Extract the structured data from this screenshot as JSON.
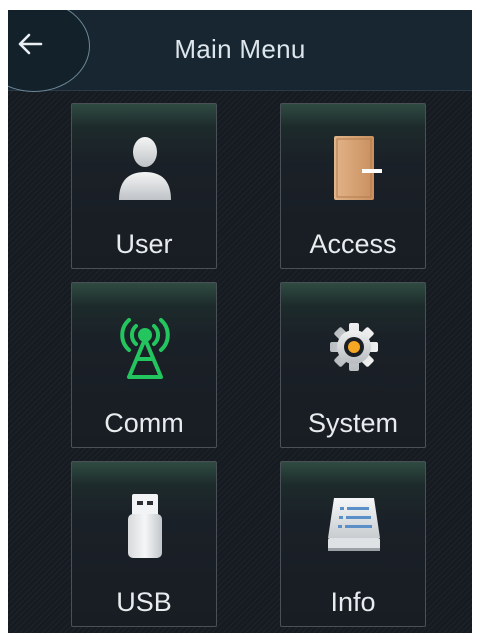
{
  "header": {
    "title": "Main Menu",
    "back_icon": "arrow-left-icon"
  },
  "menu": {
    "items": [
      {
        "id": "user",
        "label": "User",
        "icon": "user-icon"
      },
      {
        "id": "access",
        "label": "Access",
        "icon": "door-icon"
      },
      {
        "id": "comm",
        "label": "Comm",
        "icon": "antenna-icon"
      },
      {
        "id": "system",
        "label": "System",
        "icon": "gear-icon"
      },
      {
        "id": "usb",
        "label": "USB",
        "icon": "usb-drive-icon"
      },
      {
        "id": "info",
        "label": "Info",
        "icon": "info-list-icon"
      }
    ]
  },
  "colors": {
    "background": "#161b22",
    "header": "#182631",
    "comm_accent": "#22c55e",
    "system_accent": "#f5a623"
  }
}
